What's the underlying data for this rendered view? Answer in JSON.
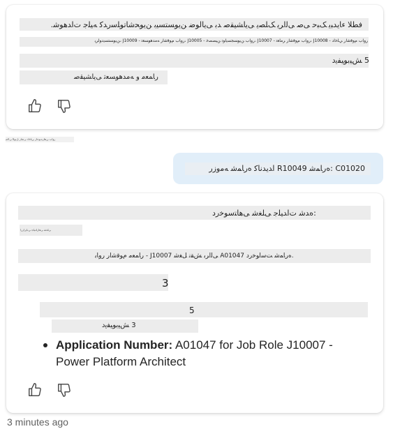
{
  "message1": {
    "line1": "فطلا ءﺎﯾﺪﺒﯾ ﮏﺒﺣ ﻰﺻ ﻰﻟاﺮﻳ ﮏﻠﺼﻳ ﻰﻳﺎﺸﻴﻘﺻ ﺪﺑ ﻰﻳﺎﻟﻮﺿ ﻦﻳﻮﺴﺘﺴﻴﺑ ﻦﻳﻮﺤﺷﺎﺗﻮﻠﺳﺭﺪﻛ ﻪﻴﻠﺟ ﺕﺍﺪﻫﻮﺷ.",
    "line2": "ﺭﻭﺎﺏ ﻡﻮﻗﺷﺍﺭ ﻲﻠﺧﺍﺩ - J10008 ،ﺭﻭﺎﺏ ﻡﻮﻗﺷﺍﺭ ﺮﻣﺎﻌﺗ - J10007 ،ﺭﻭﺎﺏ ﻦﻳﻮﺴﺠﺴﻳﺍﻮﺗ ﻦﻴﺼﺼﺧ - J10005 ،ﺭﻭﺎﺏ ﻡﻮﻗﺷﺍﺭ ﻪﻣﺪﻫﻮﺴﻌﺗ - J10009 ،ﻦﻳﻮﺴﺘﺴﻳﺩﻮﻟﺮﻳ",
    "line3": "5 ﺶﻴﺑﻮﻴﻔﻳﺩ",
    "line4": "ﺭﺎﻤﻌﻣ ﻭ ﻪﻣﺪﻫﻮﺴﻌﺗ ﻰﻳﺎﺸﻴﻘﺻ"
  },
  "tiny_strip_text": "ﺭﻭﺍﺏ ﻲﻫﺍﺭﺪﻳﻮﺣﺍﺭ ﻲﻠﺧﺍﺩ ﻰﺷﺍﺭ ﻞﻳﻮﻟﺍ ﻰﻟﺎﻌﻳ",
  "user_message": "C01020 :ﻩﺭﺎﻤﺷ R10049 ﺍﺪﻳﺪﻧﺎﻛ ﻩﺭﺎﻤﺷ ﻪﻣﻭﺯﺭ",
  "message2": {
    "heading": ":ﻩﺪﺷ ﺕﺍﺪﻴﻠﺟ ﻰﻠﻐﺷ ﻰﻫﺎﺘﺳﻮﺧﺭﺩ",
    "subtiny": "ﻰﻠﻐﺷ ﻰﻫﺍﺭﺍﺪﻴﻠﺟ ﻲﺑﺎﻳﺭﺍﺯﺭﺍ",
    "line": ".ﻩﺭﺎﻤﺷ ﺖﺳﺍﻮﺧﺭﺩ A01047 ﻰﻟﺍﺮﺑ ﺶﻘﻧ ﻞﻐﺷ J10007 - ﺭﺎﻤﻌﻣ ﻡﻮﻗﺷﺍﺭ ﺭﻭﺎﺑ",
    "num3": "3",
    "num5": "5",
    "line_3": "3 ﺶﻴﺑﻮﻴﻔﻳﺩ",
    "bullet_label": "Application Number:",
    "bullet_text": " A01047 for Job Role J10007 - Power Platform Architect"
  },
  "timestamp": "3 minutes ago"
}
